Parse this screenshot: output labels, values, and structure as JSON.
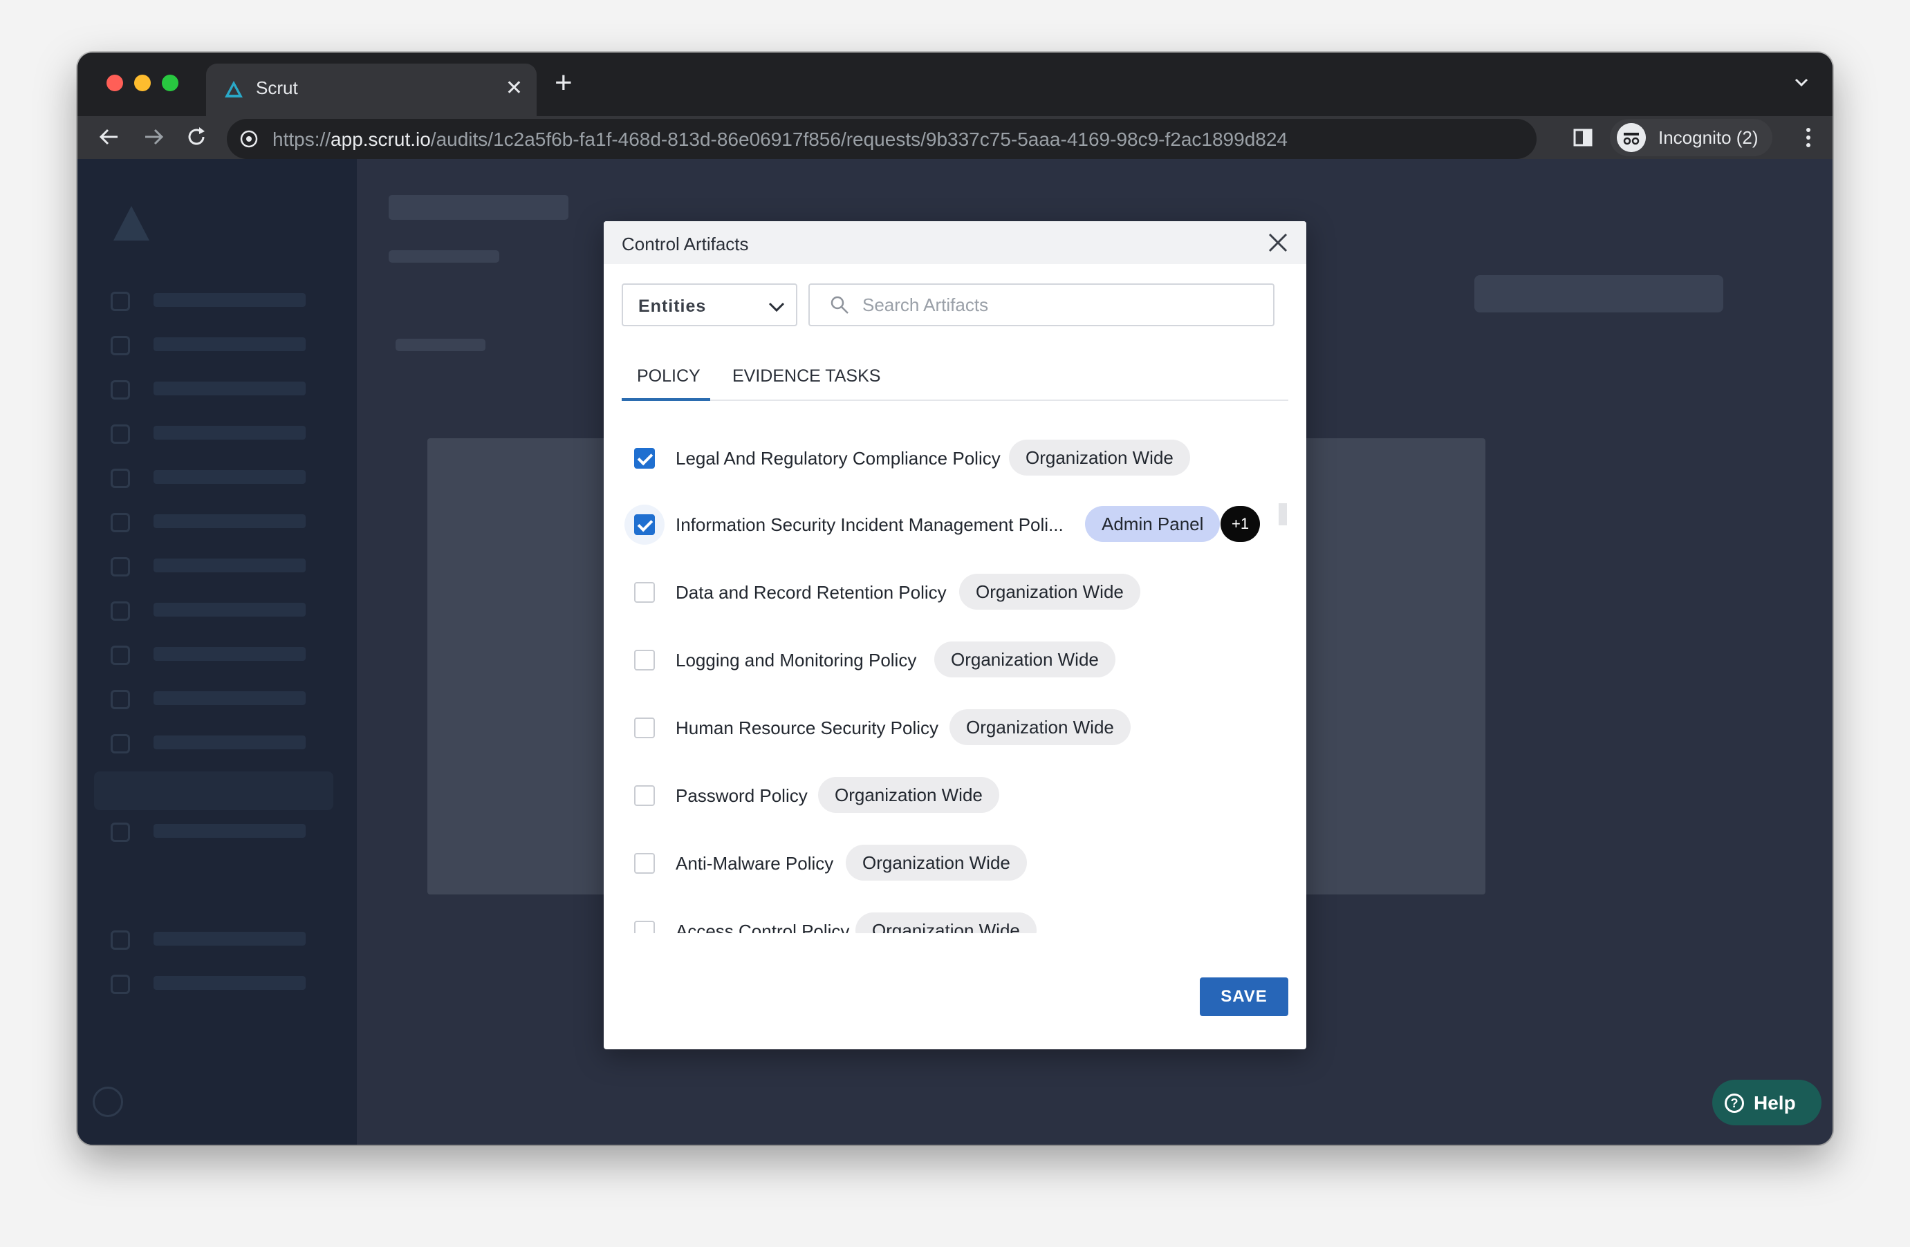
{
  "browser": {
    "tab_title": "Scrut",
    "url_scheme": "https://",
    "url_host": "app.scrut.io",
    "url_path": "/audits/1c2a5f6b-fa1f-468d-813d-86e06917f856/requests/9b337c75-5aaa-4169-98c9-f2ac1899d824",
    "incognito_label": "Incognito (2)"
  },
  "modal": {
    "title": "Control Artifacts",
    "filter_select": "Entities",
    "search_placeholder": "Search Artifacts",
    "tabs": [
      {
        "label": "POLICY",
        "active": true
      },
      {
        "label": "EVIDENCE TASKS",
        "active": false
      }
    ],
    "policies": [
      {
        "name": "Legal And Regulatory Compliance Policy",
        "checked": true,
        "chips": [
          "Organization Wide"
        ]
      },
      {
        "name": "Information Security Incident Management Poli...",
        "checked": true,
        "chips": [
          "Admin Panel",
          "+1"
        ]
      },
      {
        "name": "Data and Record Retention Policy",
        "checked": false,
        "chips": [
          "Organization Wide"
        ]
      },
      {
        "name": "Logging and Monitoring Policy",
        "checked": false,
        "chips": [
          "Organization Wide"
        ]
      },
      {
        "name": "Human Resource Security Policy",
        "checked": false,
        "chips": [
          "Organization Wide"
        ]
      },
      {
        "name": "Password Policy",
        "checked": false,
        "chips": [
          "Organization Wide"
        ]
      },
      {
        "name": "Anti-Malware Policy",
        "checked": false,
        "chips": [
          "Organization Wide"
        ]
      },
      {
        "name": "Access Control Policy",
        "checked": false,
        "chips": [
          "Organization Wide"
        ]
      }
    ],
    "save_label": "SAVE"
  },
  "help": {
    "label": "Help"
  },
  "colors": {
    "accent": "#2766b8",
    "checkbox": "#1f6fd0",
    "chip": "#ececee",
    "chip_highlight": "#c9d4f7"
  }
}
